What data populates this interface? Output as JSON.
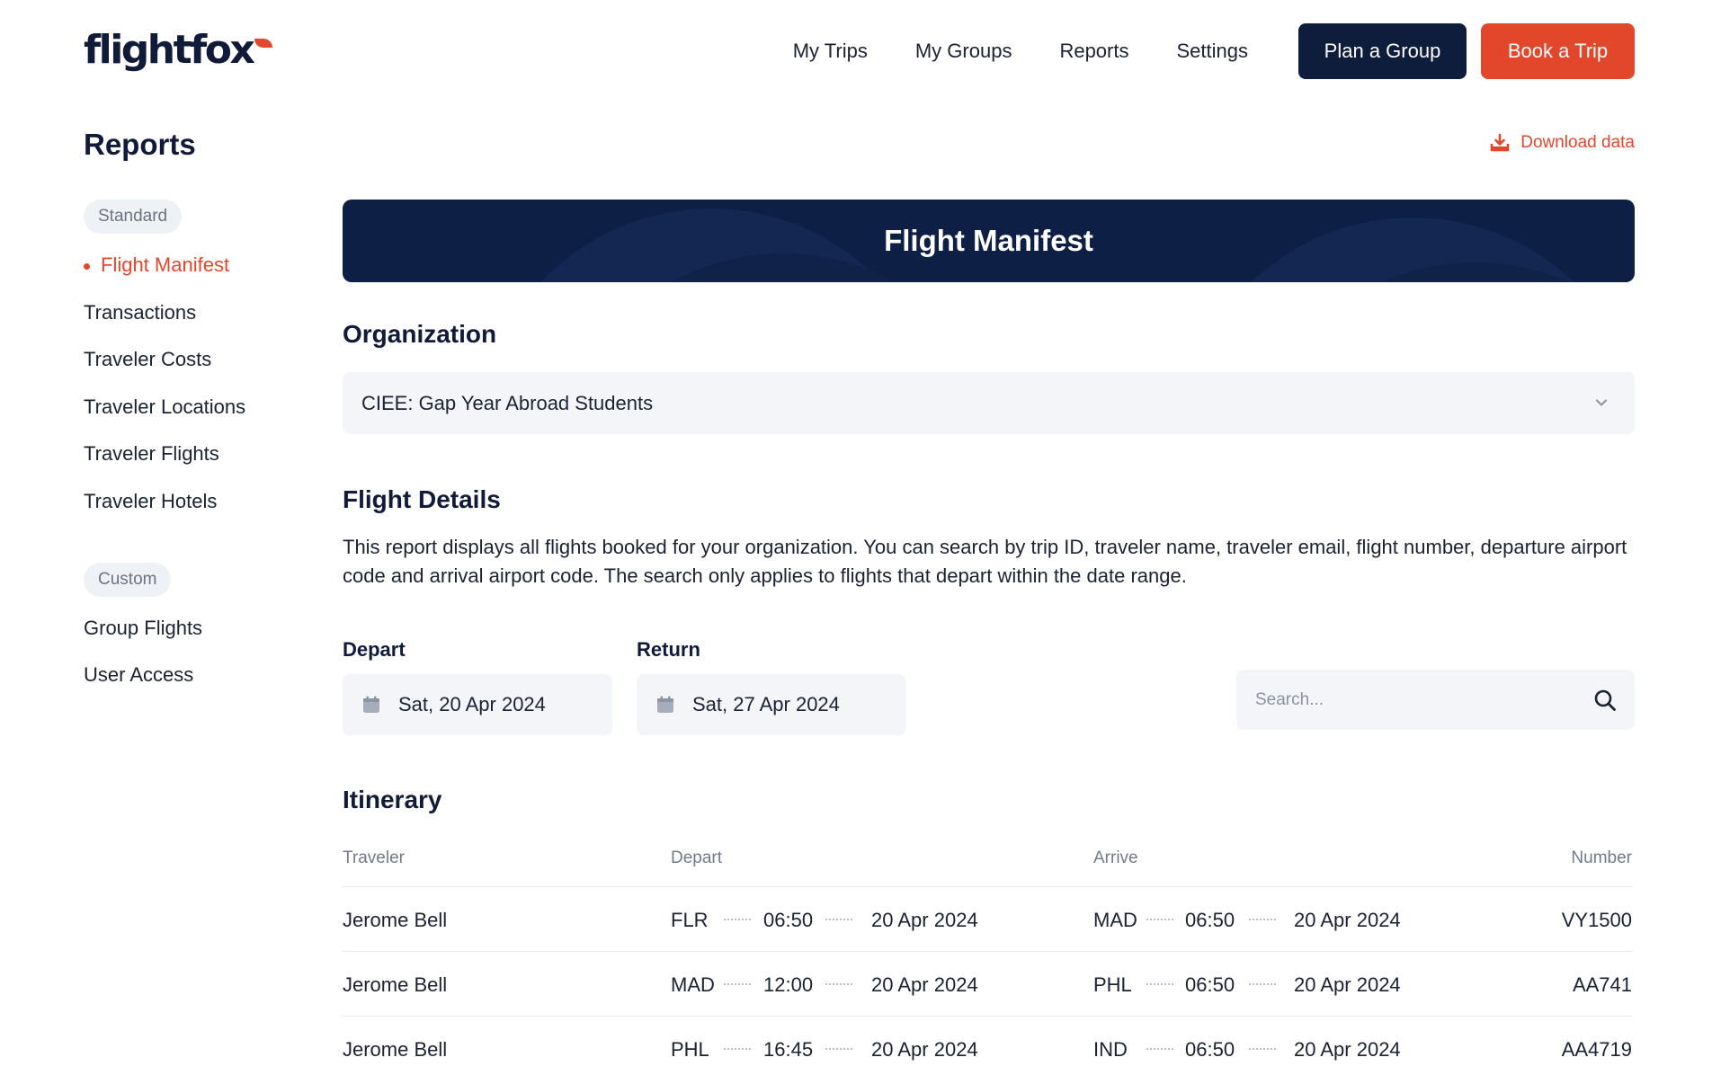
{
  "header": {
    "logo": "flightfox",
    "nav": [
      "My Trips",
      "My Groups",
      "Reports",
      "Settings"
    ],
    "plan_group": "Plan a Group",
    "book_trip": "Book a Trip"
  },
  "sidebar": {
    "title": "Reports",
    "standard_label": "Standard",
    "standard_items": [
      "Flight Manifest",
      "Transactions",
      "Traveler Costs",
      "Traveler Locations",
      "Traveler Flights",
      "Traveler Hotels"
    ],
    "custom_label": "Custom",
    "custom_items": [
      "Group Flights",
      "User Access"
    ]
  },
  "main": {
    "download": "Download data",
    "banner_title": "Flight Manifest",
    "organization_heading": "Organization",
    "organization_value": "CIEE: Gap Year Abroad Students",
    "details_heading": "Flight Details",
    "details_text": "This report displays all flights booked for your organization. You can search by trip ID, traveler name, traveler email, flight number, departure airport code and arrival airport code. The search only applies to flights that depart within the date range.",
    "depart_label": "Depart",
    "depart_value": "Sat, 20 Apr 2024",
    "return_label": "Return",
    "return_value": "Sat, 27 Apr 2024",
    "search_placeholder": "Search...",
    "itinerary_heading": "Itinerary"
  },
  "table": {
    "columns": [
      "Traveler",
      "Depart",
      "Arrive",
      "Number"
    ],
    "rows": [
      {
        "traveler": "Jerome Bell",
        "dep_code": "FLR",
        "dep_time": "06:50",
        "dep_date": "20 Apr 2024",
        "arr_code": "MAD",
        "arr_time": "06:50",
        "arr_date": "20 Apr 2024",
        "number": "VY1500"
      },
      {
        "traveler": "Jerome Bell",
        "dep_code": "MAD",
        "dep_time": "12:00",
        "dep_date": "20 Apr 2024",
        "arr_code": "PHL",
        "arr_time": "06:50",
        "arr_date": "20 Apr 2024",
        "number": "AA741"
      },
      {
        "traveler": "Jerome Bell",
        "dep_code": "PHL",
        "dep_time": "16:45",
        "dep_date": "20 Apr 2024",
        "arr_code": "IND",
        "arr_time": "06:50",
        "arr_date": "20 Apr 2024",
        "number": "AA4719"
      }
    ]
  },
  "colors": {
    "brand_navy": "#0f1d3d",
    "accent_orange": "#e3472b"
  }
}
